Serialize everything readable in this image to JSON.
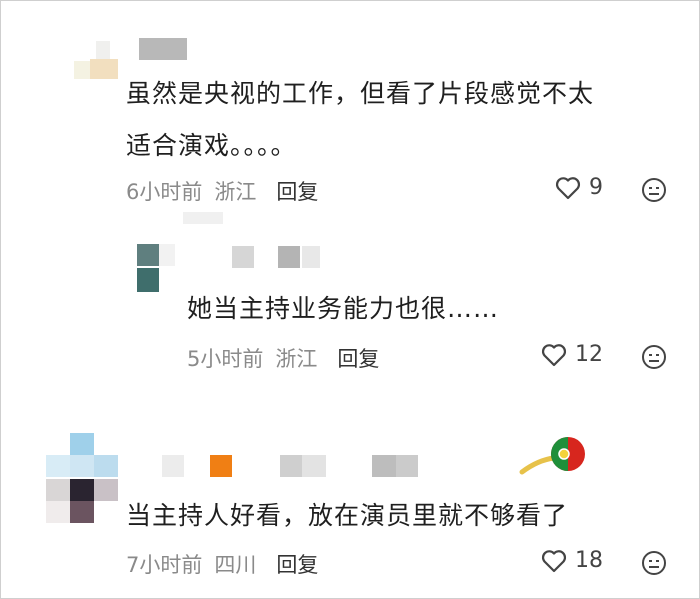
{
  "comments": [
    {
      "text_line1": "虽然是央视的工作，但看了片段感觉不太",
      "text_line2": "适合演戏。。。。",
      "time": "6小时前",
      "location": "浙江",
      "reply_label": "回复",
      "likes": "9"
    },
    {
      "text_line1": "她当主持业务能力也很……",
      "time": "5小时前",
      "location": "浙江",
      "reply_label": "回复",
      "likes": "12"
    },
    {
      "text_line1": "当主持人好看，放在演员里就不够看了",
      "time": "7小时前",
      "location": "四川",
      "reply_label": "回复",
      "likes": "18"
    }
  ],
  "icons": {
    "like": "heart-outline-icon",
    "dislike": "neutral-face-icon",
    "badge": "portugal-flag-badge-icon"
  },
  "colors": {
    "text": "#1f1f1f",
    "meta": "#8a8a8a",
    "badge_red": "#d7261e",
    "badge_green": "#1f8f3a"
  }
}
